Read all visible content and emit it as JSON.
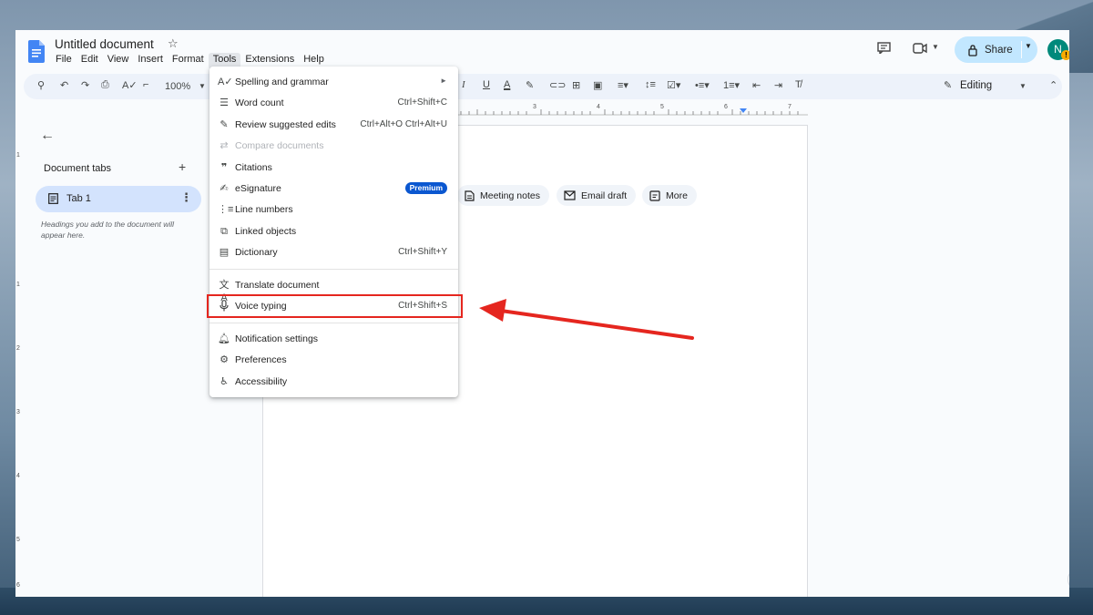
{
  "document": {
    "title": "Untitled document"
  },
  "menubar": {
    "items": [
      "File",
      "Edit",
      "View",
      "Insert",
      "Format",
      "Tools",
      "Extensions",
      "Help"
    ],
    "active": "Tools"
  },
  "header": {
    "share_label": "Share",
    "avatar_initial": "N",
    "avatar_badge": "!",
    "colors": {
      "share_bg": "#c2e7ff",
      "avatar_bg": "#00897b",
      "badge": "#f9ab00"
    }
  },
  "toolbar": {
    "zoom": "100%",
    "mode": "Editing"
  },
  "ruler": {
    "numbers": [
      "3",
      "4",
      "5",
      "6",
      "7"
    ]
  },
  "vruler": {
    "numbers": [
      "1",
      "1",
      "2",
      "3",
      "4",
      "5",
      "6"
    ]
  },
  "sidebar": {
    "heading": "Document tabs",
    "tab_label": "Tab 1",
    "hint": "Headings you add to the document will appear here."
  },
  "chips": [
    {
      "label": "Meeting notes",
      "icon": "document-icon"
    },
    {
      "label": "Email draft",
      "icon": "email-icon"
    },
    {
      "label": "More",
      "icon": "more-icon"
    }
  ],
  "tools_menu": {
    "items": [
      {
        "label": "Spelling and grammar",
        "icon": "spellcheck-icon",
        "submenu": true
      },
      {
        "label": "Word count",
        "icon": "word-count-icon",
        "shortcut": "Ctrl+Shift+C"
      },
      {
        "label": "Review suggested edits",
        "icon": "review-icon",
        "shortcut": "Ctrl+Alt+O Ctrl+Alt+U"
      },
      {
        "label": "Compare documents",
        "icon": "compare-icon",
        "disabled": true
      },
      {
        "label": "Citations",
        "icon": "quote-icon"
      },
      {
        "label": "eSignature",
        "icon": "signature-icon",
        "badge": "Premium"
      },
      {
        "label": "Line numbers",
        "icon": "line-numbers-icon"
      },
      {
        "label": "Linked objects",
        "icon": "linked-objects-icon"
      },
      {
        "label": "Dictionary",
        "icon": "dictionary-icon",
        "shortcut": "Ctrl+Shift+Y"
      },
      {
        "label": "Translate document",
        "icon": "translate-icon"
      },
      {
        "label": "Voice typing",
        "icon": "microphone-icon",
        "shortcut": "Ctrl+Shift+S",
        "highlighted": true
      },
      {
        "label": "Notification settings",
        "icon": "bell-icon"
      },
      {
        "label": "Preferences",
        "icon": "preferences-icon"
      },
      {
        "label": "Accessibility",
        "icon": "accessibility-icon"
      }
    ]
  },
  "annotation": {
    "color": "#e5261f"
  }
}
